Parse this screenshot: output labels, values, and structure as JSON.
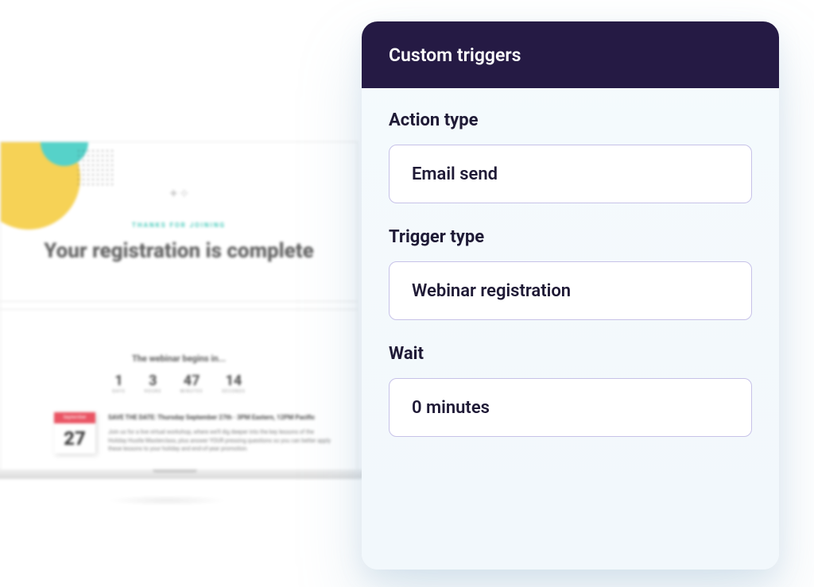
{
  "background": {
    "thanks_label": "THANKS FOR JOINING",
    "headline": "Your registration is complete",
    "begins_label": "The webinar begins in...",
    "countdown": [
      {
        "value": "1",
        "unit": "DAYS"
      },
      {
        "value": "3",
        "unit": "HOURS"
      },
      {
        "value": "47",
        "unit": "MINUTES"
      },
      {
        "value": "14",
        "unit": "SECONDS"
      }
    ],
    "calendar": {
      "month": "September",
      "day": "27"
    },
    "save_date": "SAVE THE DATE: Thursday September 27th · 3PM Eastern, 12PM Pacific",
    "description": "Join us for a live virtual workshop, where we'll dig deeper into the key lessons of the Holiday Hustle Masterclass, plus answer YOUR pressing questions so you can better apply these lessons to your holiday and end-of-year promotion."
  },
  "panel": {
    "title": "Custom triggers",
    "fields": [
      {
        "label": "Action type",
        "value": "Email send"
      },
      {
        "label": "Trigger type",
        "value": "Webinar registration"
      },
      {
        "label": "Wait",
        "value": "0 minutes"
      }
    ]
  }
}
